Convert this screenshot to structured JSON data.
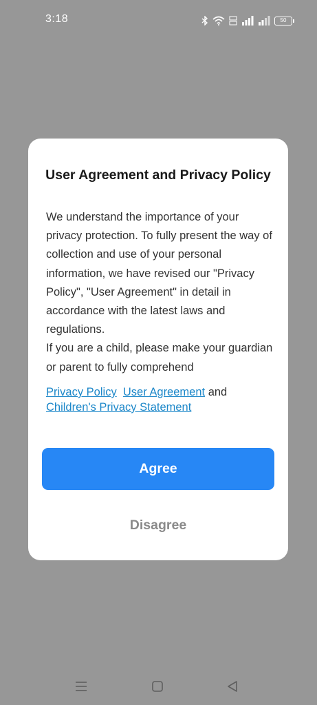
{
  "status_bar": {
    "time": "3:18",
    "battery_level": "50",
    "icons": [
      "bluetooth-icon",
      "wifi-icon",
      "volte-icon",
      "signal-icon",
      "signal-icon",
      "battery-icon"
    ]
  },
  "dialog": {
    "title": "User Agreement and Privacy Policy",
    "body_paragraph_1": "We understand the importance of your privacy protection. To fully present the way of collection and use of your personal information, we have revised our \"Privacy Policy\", \"User Agreement\" in detail in accordance with the latest laws and regulations.",
    "body_paragraph_2": "If you are a child, please make your guardian or parent to fully comprehend",
    "links": {
      "privacy_policy": "Privacy Policy",
      "user_agreement": "User Agreement",
      "conjunction": "and",
      "childrens_privacy": "Children's Privacy Statement"
    },
    "agree_label": "Agree",
    "disagree_label": "Disagree"
  },
  "nav_bar": {
    "icons": [
      "menu-icon",
      "home-icon",
      "back-icon"
    ]
  },
  "colors": {
    "overlay": "#979797",
    "accent": "#2787f5",
    "link": "#1c87c9",
    "dialog_background": "#ffffff"
  }
}
